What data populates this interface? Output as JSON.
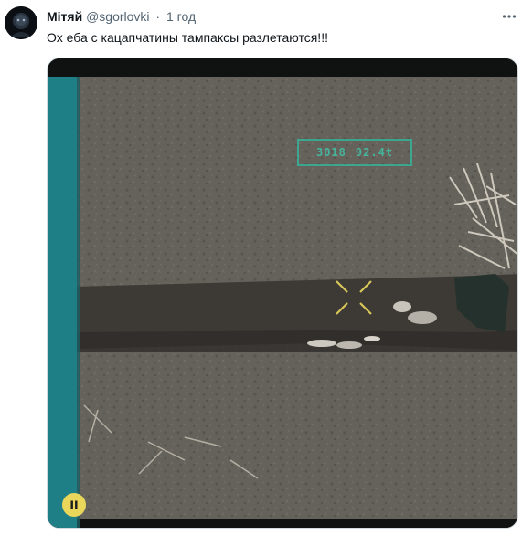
{
  "tweet": {
    "author_name": "Мітяй",
    "handle": "@sgorlovki",
    "separator": "·",
    "time": "1 год",
    "text": "Ох еба с кацапчатины тампаксы разлетаются!!!"
  },
  "media": {
    "type": "video",
    "hud_readout": [
      "3018",
      "92.4t"
    ],
    "overlay_color": "#35b39a",
    "side_bar_color": "#1f7f86"
  },
  "icons": {
    "avatar": "profile-avatar",
    "more": "more-horizontal-icon",
    "pause": "pause-icon",
    "crosshair": "crosshair-icon"
  }
}
